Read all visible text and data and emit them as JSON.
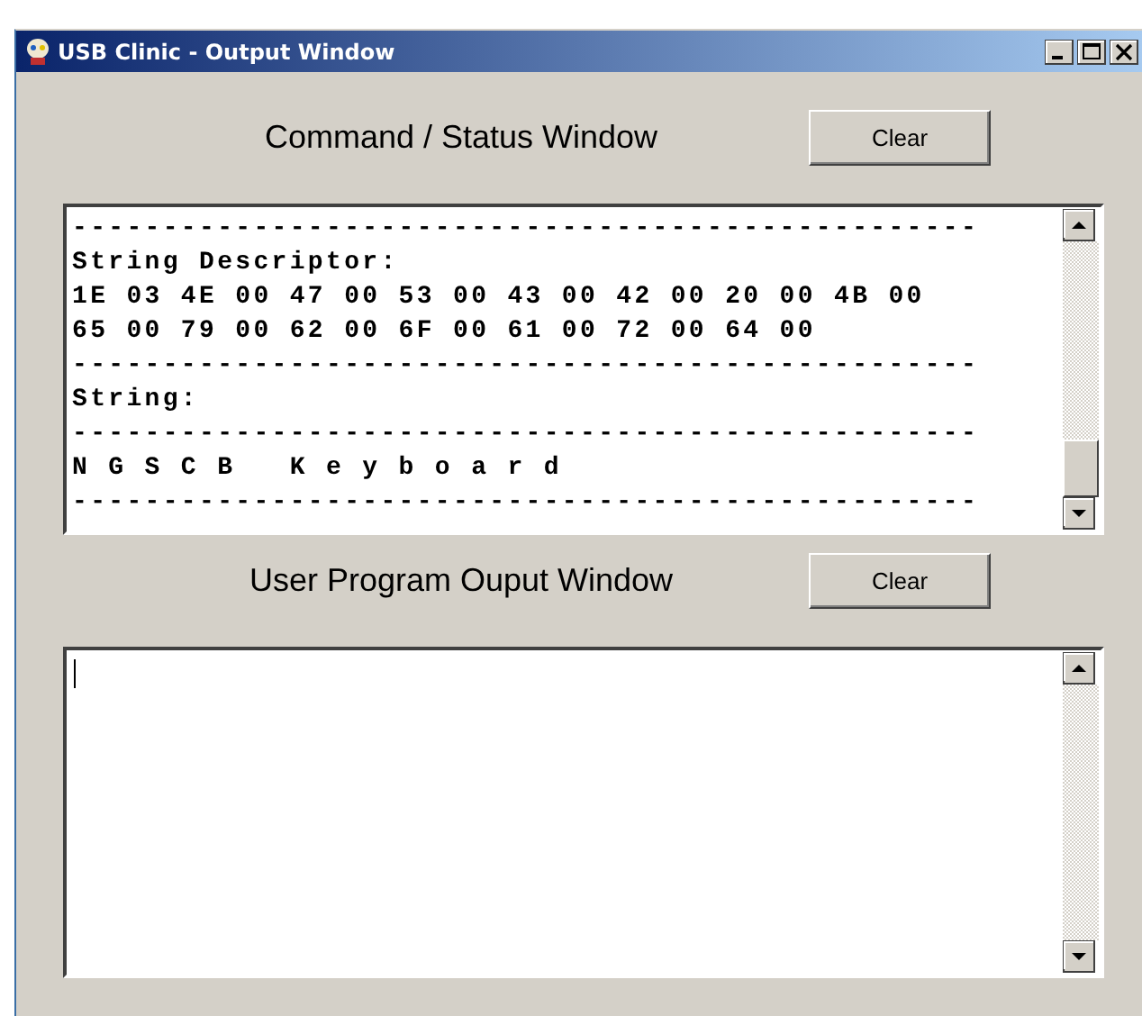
{
  "window": {
    "title": "USB Clinic - Output Window"
  },
  "panes": [
    {
      "label": "Command / Status Window",
      "clear_button": "Clear",
      "lines": [
        "--------------------------------------------------",
        "String Descriptor:",
        "1E 03 4E 00 47 00 53 00 43 00 42 00 20 00 4B 00",
        "65 00 79 00 62 00 6F 00 61 00 72 00 64 00",
        "--------------------------------------------------",
        "String:",
        "--------------------------------------------------",
        "N G S C B   K e y b o a r d",
        "--------------------------------------------------"
      ]
    },
    {
      "label": "User Program Ouput Window",
      "clear_button": "Clear"
    }
  ]
}
